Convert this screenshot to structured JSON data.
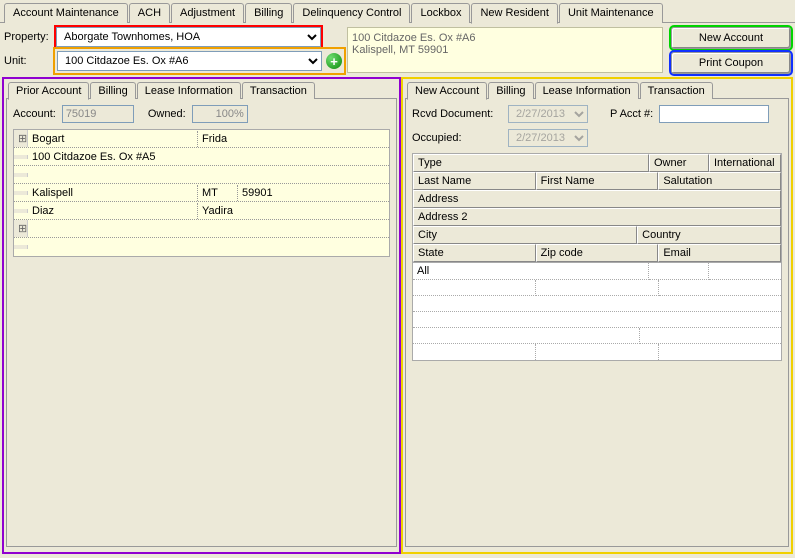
{
  "main_tabs": [
    "Account Maintenance",
    "ACH",
    "Adjustment",
    "Billing",
    "Delinquency Control",
    "Lockbox",
    "New Resident",
    "Unit Maintenance"
  ],
  "main_active": "New Resident",
  "property": {
    "label": "Property:",
    "value": "Aborgate Townhomes, HOA"
  },
  "unit": {
    "label": "Unit:",
    "value": "100 Citdazoe Es. Ox #A6"
  },
  "address_block": {
    "line1": "100 Citdazoe Es. Ox #A6",
    "line2": "Kalispell, MT 59901"
  },
  "buttons": {
    "new_account": "New Account",
    "print_coupon": "Print Coupon"
  },
  "left": {
    "tabs": [
      "Prior Account",
      "Billing",
      "Lease Information",
      "Transaction"
    ],
    "active": "Prior Account",
    "account_label": "Account:",
    "account_value": "75019",
    "owned_label": "Owned:",
    "owned_value": "100%",
    "rows": {
      "name_last": "Bogart",
      "name_first": "Frida",
      "addr1": "100 Citdazoe Es. Ox #A5",
      "city": "Kalispell",
      "state": "MT",
      "zip": "59901",
      "last2": "Diaz",
      "first2": "Yadira"
    }
  },
  "right": {
    "tabs": [
      "New Account",
      "Billing",
      "Lease Information",
      "Transaction"
    ],
    "active": "New Account",
    "rcvd_label": "Rcvd Document:",
    "rcvd_value": "2/27/2013",
    "pacct_label": "P Acct #:",
    "pacct_value": "",
    "occupied_label": "Occupied:",
    "occupied_value": "2/27/2013",
    "headers": {
      "type": "Type",
      "owner": "Owner",
      "intl": "International",
      "last": "Last Name",
      "first": "First Name",
      "sal": "Salutation",
      "addr": "Address",
      "addr2": "Address 2",
      "city": "City",
      "country": "Country",
      "state": "State",
      "zip": "Zip code",
      "email": "Email",
      "all": "All"
    }
  }
}
